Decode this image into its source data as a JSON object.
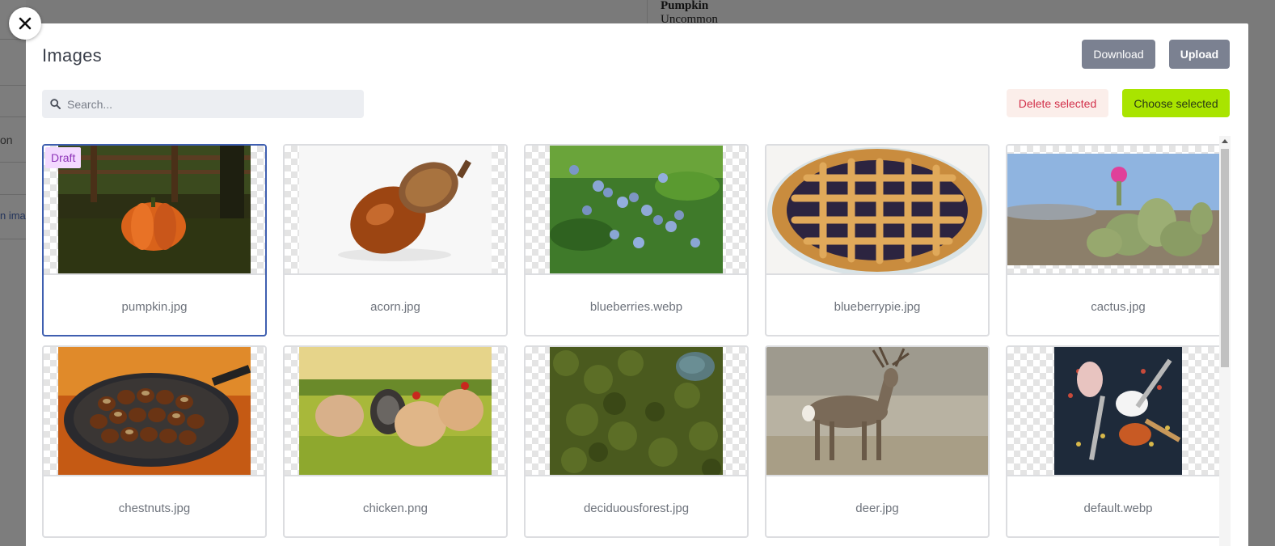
{
  "background": {
    "left_text_1": "on",
    "left_text_2": "n ima",
    "right_title": "Pumpkin",
    "right_subtitle": "Uncommon"
  },
  "modal": {
    "title": "Images",
    "download_label": "Download",
    "upload_label": "Upload",
    "search_placeholder": "Search...",
    "delete_label": "Delete selected",
    "choose_label": "Choose selected"
  },
  "images": [
    {
      "name": "pumpkin.jpg",
      "badge": "Draft",
      "selected": true
    },
    {
      "name": "acorn.jpg"
    },
    {
      "name": "blueberries.webp"
    },
    {
      "name": "blueberrypie.jpg"
    },
    {
      "name": "cactus.jpg"
    },
    {
      "name": "chestnuts.jpg"
    },
    {
      "name": "chicken.png"
    },
    {
      "name": "deciduousforest.jpg"
    },
    {
      "name": "deer.jpg"
    },
    {
      "name": "default.webp"
    }
  ],
  "icons": {
    "close": "close-icon",
    "search": "search-icon"
  }
}
